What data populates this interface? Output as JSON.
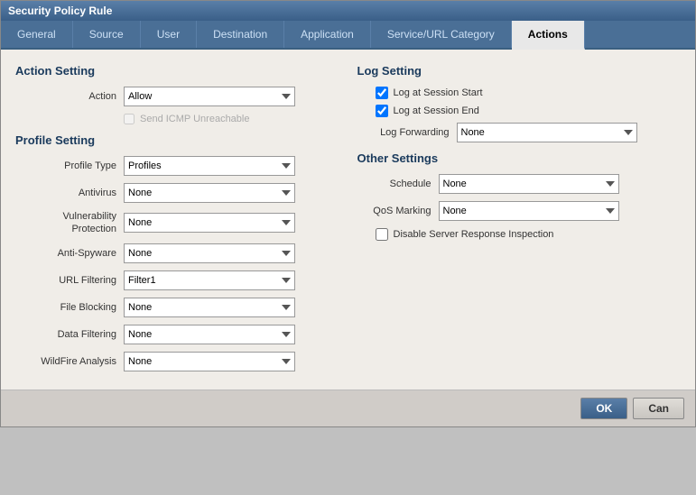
{
  "window": {
    "title": "Security Policy Rule"
  },
  "tabs": [
    {
      "id": "general",
      "label": "General"
    },
    {
      "id": "source",
      "label": "Source"
    },
    {
      "id": "user",
      "label": "User"
    },
    {
      "id": "destination",
      "label": "Destination"
    },
    {
      "id": "application",
      "label": "Application"
    },
    {
      "id": "service-url",
      "label": "Service/URL Category"
    },
    {
      "id": "actions",
      "label": "Actions"
    }
  ],
  "active_tab": "Actions",
  "left": {
    "action_setting_title": "Action Setting",
    "action_label": "Action",
    "action_value": "Allow",
    "send_icmp_label": "Send ICMP Unreachable",
    "profile_setting_title": "Profile Setting",
    "profile_type_label": "Profile Type",
    "profile_type_value": "Profiles",
    "antivirus_label": "Antivirus",
    "antivirus_value": "None",
    "vuln_protection_label": "Vulnerability Protection",
    "vuln_protection_value": "None",
    "anti_spyware_label": "Anti-Spyware",
    "anti_spyware_value": "None",
    "url_filtering_label": "URL Filtering",
    "url_filtering_value": "Filter1",
    "file_blocking_label": "File Blocking",
    "file_blocking_value": "None",
    "data_filtering_label": "Data Filtering",
    "data_filtering_value": "None",
    "wildfire_label": "WildFire Analysis",
    "wildfire_value": "None"
  },
  "right": {
    "log_setting_title": "Log Setting",
    "log_session_start_label": "Log at Session Start",
    "log_session_start_checked": true,
    "log_session_end_label": "Log at Session End",
    "log_session_end_checked": true,
    "log_forwarding_label": "Log Forwarding",
    "log_forwarding_value": "None",
    "other_settings_title": "Other Settings",
    "schedule_label": "Schedule",
    "schedule_value": "None",
    "qos_marking_label": "QoS Marking",
    "qos_marking_value": "None",
    "disable_server_label": "Disable Server Response Inspection"
  },
  "footer": {
    "ok_label": "OK",
    "cancel_label": "Can"
  }
}
